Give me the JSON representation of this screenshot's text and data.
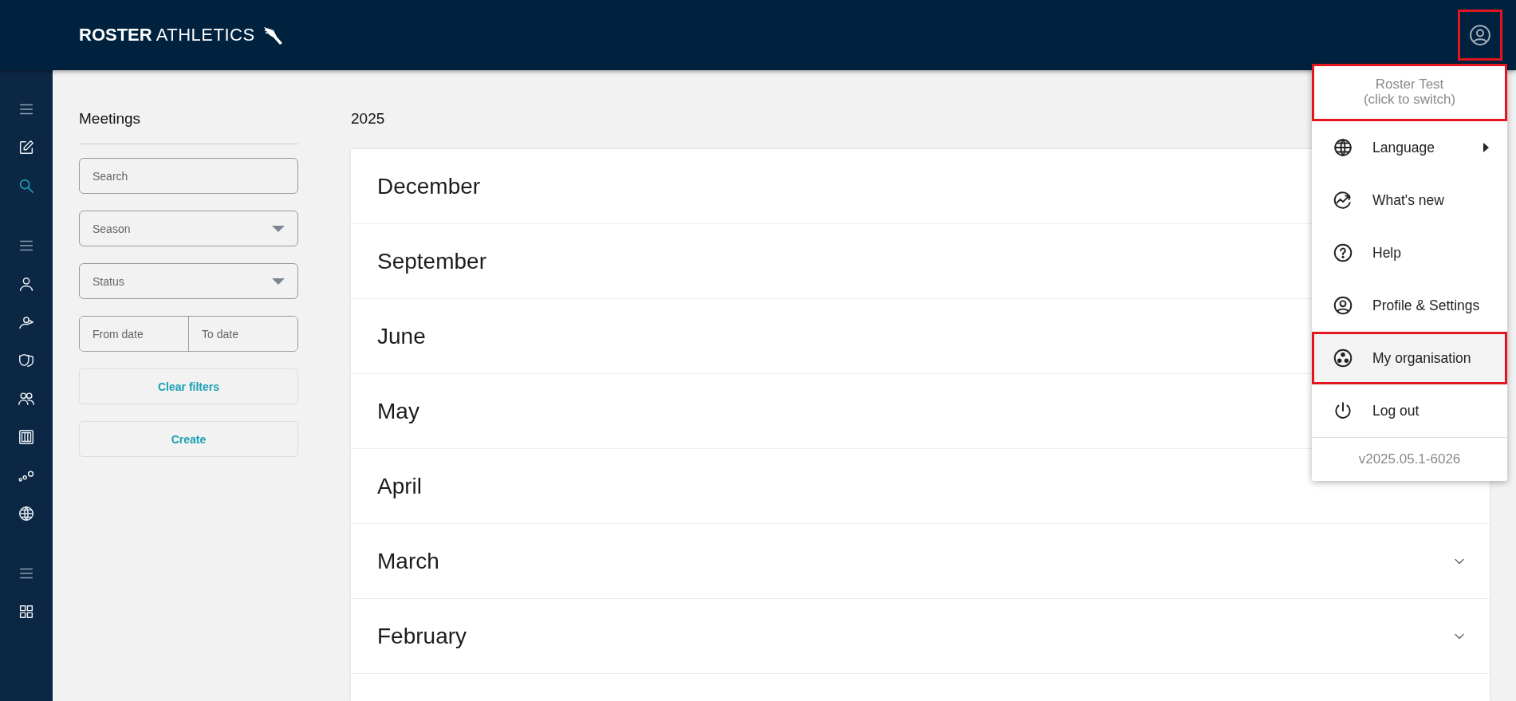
{
  "header": {
    "logo": {
      "bold": "ROSTER",
      "light": "ATHLETICS"
    },
    "account_button": {
      "highlighted": true
    }
  },
  "sidebar": {
    "sections": [
      {
        "items": [
          {
            "selected": false
          },
          {
            "selected": true
          }
        ]
      },
      {
        "items": [
          {
            "selected": false
          },
          {
            "selected": false
          },
          {
            "selected": false
          },
          {
            "selected": false
          },
          {
            "selected": false
          },
          {
            "selected": false
          },
          {
            "selected": false
          }
        ]
      },
      {
        "items": [
          {
            "selected": false
          }
        ]
      }
    ]
  },
  "filters": {
    "title": "Meetings",
    "fields": [
      {
        "kind": "text",
        "placeholder": "Search"
      },
      {
        "kind": "select",
        "placeholder": "Season"
      },
      {
        "kind": "select",
        "placeholder": "Status"
      },
      {
        "kind": "range",
        "placeholders": [
          "From date",
          "To date"
        ]
      }
    ],
    "buttons": [
      "Clear filters",
      "Create"
    ]
  },
  "year": "2025",
  "months": [
    {
      "label": "December"
    },
    {
      "label": "September"
    },
    {
      "label": "June"
    },
    {
      "label": "May"
    },
    {
      "label": "April"
    },
    {
      "label": "March"
    },
    {
      "label": "February"
    }
  ],
  "account_menu": {
    "account": {
      "name": "Roster Test",
      "hint": "(click to switch)",
      "highlighted": true
    },
    "items": [
      {
        "label": "Language",
        "submenu": true,
        "hovered": false,
        "highlighted": false
      },
      {
        "label": "What's new",
        "submenu": false,
        "hovered": false,
        "highlighted": false
      },
      {
        "label": "Help",
        "submenu": false,
        "hovered": false,
        "highlighted": false
      },
      {
        "label": "Profile & Settings",
        "submenu": false,
        "hovered": false,
        "highlighted": false
      },
      {
        "label": "My organisation",
        "submenu": false,
        "hovered": true,
        "highlighted": true
      },
      {
        "label": "Log out",
        "submenu": false,
        "hovered": false,
        "highlighted": false
      }
    ],
    "version": "v2025.05.1-6026"
  }
}
